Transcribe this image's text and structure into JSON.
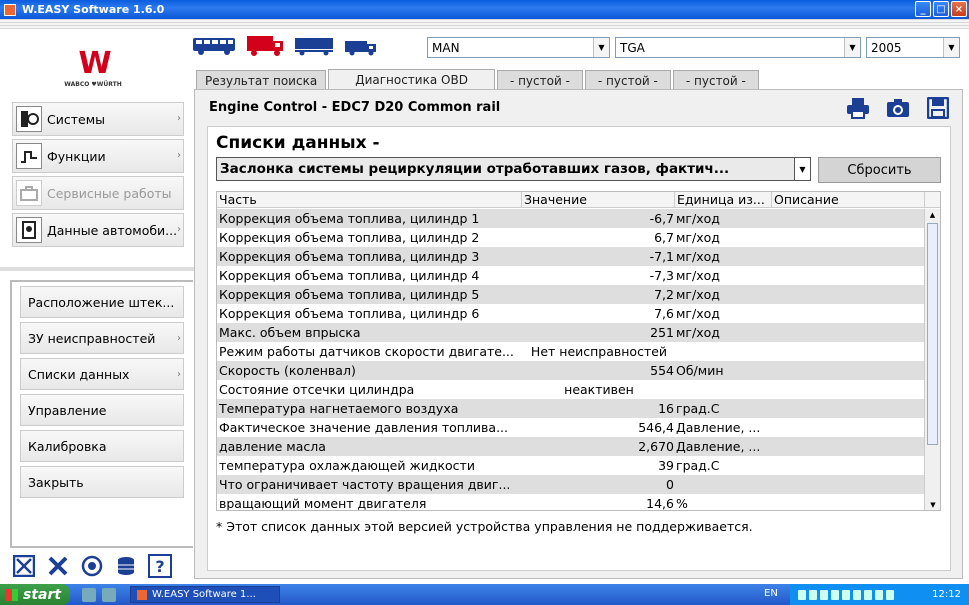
{
  "window": {
    "title": "W.EASY Software 1.6.0",
    "min": "_",
    "max": "□",
    "close": "×"
  },
  "logo": {
    "mark": "W",
    "text": "WABCO ♥WÜRTH"
  },
  "vehicle": {
    "brand": "MAN",
    "model": "TGA",
    "year": "2005"
  },
  "tabs": [
    {
      "label": "Результат поиска"
    },
    {
      "label": "Диагностика OBD"
    },
    {
      "label": "- пустой -"
    },
    {
      "label": "- пустой -"
    },
    {
      "label": "- пустой -"
    }
  ],
  "ecu_title": "Engine Control - EDC7 D20 Common rail",
  "lists_heading": "Списки данных -",
  "dropdown_value": "Заслонка системы рециркуляции отработавших газов, фактич...",
  "reset_label": "Сбросить",
  "grid": {
    "headers": [
      "Часть",
      "Значение",
      "Единица из...",
      "Описание"
    ],
    "rows": [
      {
        "part": "Коррекция объема топлива, цилиндр 1",
        "value": "-6,7",
        "unit": "мг/ход"
      },
      {
        "part": "Коррекция объема топлива, цилиндр 2",
        "value": "6,7",
        "unit": "мг/ход"
      },
      {
        "part": "Коррекция объема топлива, цилиндр 3",
        "value": "-7,1",
        "unit": "мг/ход"
      },
      {
        "part": "Коррекция объема топлива, цилиндр 4",
        "value": "-7,3",
        "unit": "мг/ход"
      },
      {
        "part": "Коррекция объема топлива, цилиндр 5",
        "value": "7,2",
        "unit": "мг/ход"
      },
      {
        "part": "Коррекция объема топлива, цилиндр 6",
        "value": "7,6",
        "unit": "мг/ход"
      },
      {
        "part": "Макс. объем впрыска",
        "value": "251",
        "unit": "мг/ход"
      },
      {
        "part": "Режим работы датчиков скорости двигате...",
        "value": "Нет неисправностей",
        "unit": ""
      },
      {
        "part": "Скорость (коленвал)",
        "value": "554",
        "unit": "Об/мин"
      },
      {
        "part": "Состояние отсечки цилиндра",
        "value": "неактивен",
        "unit": ""
      },
      {
        "part": "Температура нагнетаемого воздуха",
        "value": "16",
        "unit": "град.С"
      },
      {
        "part": "Фактическое значение давления топлива...",
        "value": "546,4",
        "unit": "Давление, ..."
      },
      {
        "part": "давление масла",
        "value": "2,670",
        "unit": "Давление, ..."
      },
      {
        "part": "температура охлаждающей жидкости",
        "value": "39",
        "unit": "град.С"
      },
      {
        "part": "Что ограничивает частоту вращения двиг...",
        "value": "0",
        "unit": ""
      },
      {
        "part": "вращающий момент двигателя",
        "value": "14,6",
        "unit": "%"
      }
    ]
  },
  "footnote": "* Этот список данных этой версией устройства управления не поддерживается.",
  "sidebar_top": [
    {
      "label": "Системы"
    },
    {
      "label": "Функции"
    },
    {
      "label": "Сервисные работы"
    },
    {
      "label": "Данные автомоби..."
    }
  ],
  "sidebar_bottom": [
    {
      "label": "Расположение штек..."
    },
    {
      "label": "ЗУ неисправностей"
    },
    {
      "label": "Списки данных"
    },
    {
      "label": "Управление"
    },
    {
      "label": "Калибровка"
    },
    {
      "label": "Закрыть"
    }
  ],
  "bottom_help": "?",
  "taskbar": {
    "start": "start",
    "task": "W.EASY Software 1...",
    "lang": "EN",
    "clock": "12:12"
  },
  "colors": {
    "accent": "#0a5ddd",
    "brand_red": "#d3001b",
    "truck_blue": "#1a3f94",
    "truck_red": "#d3001b"
  }
}
